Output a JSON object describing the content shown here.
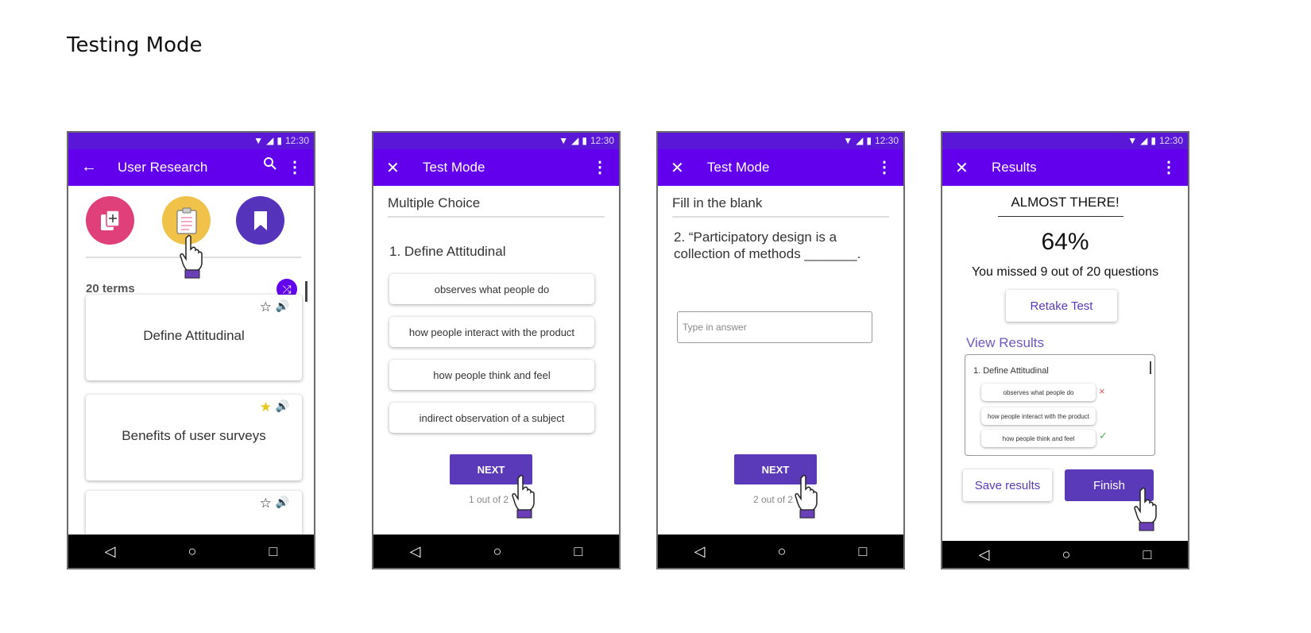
{
  "page": {
    "title": "Testing Mode"
  },
  "status": {
    "time": "12:30"
  },
  "phone1": {
    "appbar": {
      "title": "User Research",
      "back_icon": "arrow-left-icon",
      "search_icon": "search-icon",
      "more_icon": "more-vert-icon"
    },
    "actions": [
      {
        "name": "add-flashcards-icon",
        "color": "#e0407a"
      },
      {
        "name": "clipboard-test-icon",
        "color": "#f1c24a"
      },
      {
        "name": "bookmark-icon",
        "color": "#5533bb"
      }
    ],
    "terms_count": "20 terms",
    "cards": [
      {
        "label": "Define Attitudinal",
        "starred": false
      },
      {
        "label": "Benefits of user surveys",
        "starred": true
      },
      {
        "label": "",
        "starred": false
      }
    ]
  },
  "phone2": {
    "appbar": {
      "title": "Test Mode"
    },
    "section": "Multiple Choice",
    "question": "1. Define Attitudinal",
    "options": [
      "observes what people do",
      "how people interact with the product",
      "how people think and feel",
      "indirect observation of a subject"
    ],
    "next_label": "NEXT",
    "progress": "1 out of 2"
  },
  "phone3": {
    "appbar": {
      "title": "Test Mode"
    },
    "section": "Fill in the blank",
    "question_line1": "2.  “Participatory design is a",
    "question_line2": "collection of methods _______.",
    "input_placeholder": "Type in answer",
    "next_label": "NEXT",
    "progress": "2 out of 2"
  },
  "phone4": {
    "appbar": {
      "title": "Results"
    },
    "heading": "ALMOST THERE!",
    "score": "64%",
    "missed": "You missed 9 out of 20 questions",
    "retake_label": "Retake Test",
    "view_results": "View Results",
    "result_question": "1. Define Attitudinal",
    "result_options": [
      {
        "text": "observes what people do",
        "mark": "×",
        "mark_color": "#e05555"
      },
      {
        "text": "how people interact with the product",
        "mark": "",
        "mark_color": ""
      },
      {
        "text": "how people think and feel",
        "mark": "✓",
        "mark_color": "#4caf50"
      }
    ],
    "save_label": "Save results",
    "finish_label": "Finish"
  },
  "colors": {
    "statusbar": "#5a17d8",
    "appbar": "#6200ee",
    "button": "#5a3ab8"
  }
}
